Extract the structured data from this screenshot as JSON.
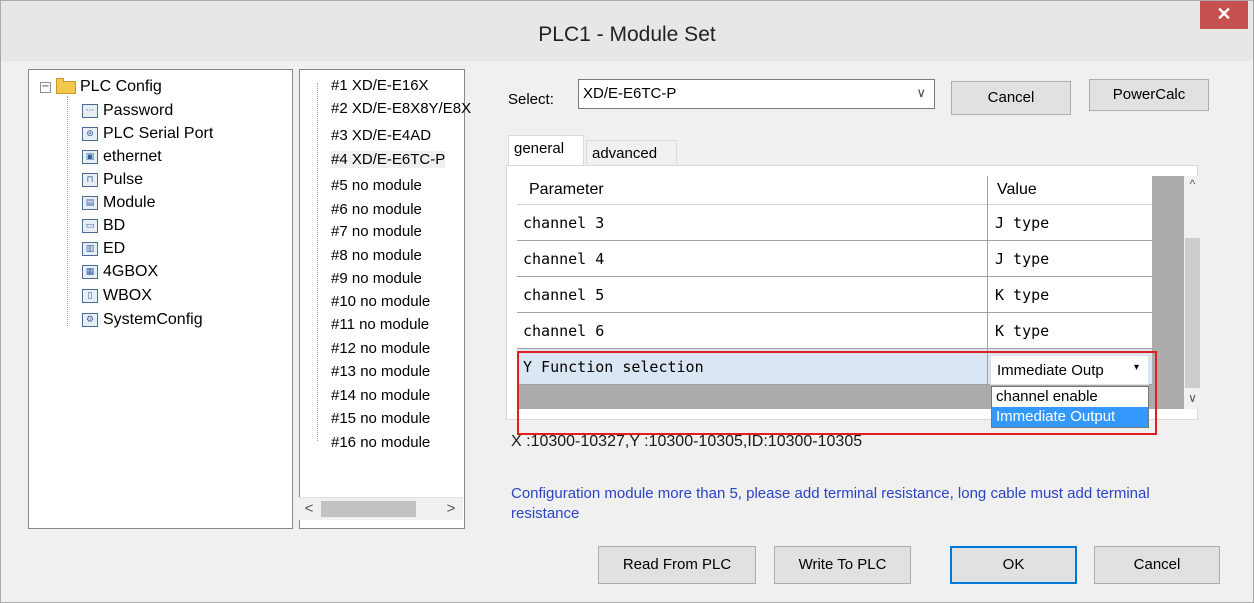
{
  "window": {
    "title": "PLC1 - Module  Set",
    "close_glyph": "✕"
  },
  "tree": {
    "root": {
      "label": "PLC Config",
      "expander": "−"
    },
    "items": [
      {
        "label": "Password",
        "icon": "password-icon",
        "glyph": "···"
      },
      {
        "label": "PLC Serial Port",
        "icon": "serial-port-icon",
        "glyph": "⊛"
      },
      {
        "label": "ethernet",
        "icon": "ethernet-icon",
        "glyph": "▣"
      },
      {
        "label": "Pulse",
        "icon": "pulse-icon",
        "glyph": "⊓"
      },
      {
        "label": "Module",
        "icon": "module-icon",
        "glyph": "▤"
      },
      {
        "label": "BD",
        "icon": "bd-icon",
        "glyph": "▭"
      },
      {
        "label": "ED",
        "icon": "ed-icon",
        "glyph": "▥"
      },
      {
        "label": "4GBOX",
        "icon": "4gbox-icon",
        "glyph": "▦"
      },
      {
        "label": "WBOX",
        "icon": "wbox-icon",
        "glyph": "▯"
      },
      {
        "label": "SystemConfig",
        "icon": "gear-icon",
        "glyph": "⚙"
      }
    ]
  },
  "modules": [
    "#1 XD/E-E16X",
    "#2 XD/E-E8X8Y/E8X",
    "#3 XD/E-E4AD",
    "#4 XD/E-E6TC-P",
    "#5 no module",
    "#6 no module",
    "#7 no module",
    "#8 no module",
    "#9 no module",
    "#10 no module",
    "#11 no module",
    "#12 no module",
    "#13 no module",
    "#14 no module",
    "#15 no module",
    "#16 no module"
  ],
  "select": {
    "label": "Select:",
    "value": "XD/E-E6TC-P",
    "chevron": "∨"
  },
  "buttons": {
    "cancel_top": "Cancel",
    "powercalc": "PowerCalc",
    "read": "Read From PLC",
    "write": "Write To PLC",
    "ok": "OK",
    "cancel_bottom": "Cancel"
  },
  "tabs": [
    "general",
    "advanced"
  ],
  "grid": {
    "headers": [
      "Parameter",
      "Value"
    ],
    "rows": [
      [
        "channel 3",
        "J type"
      ],
      [
        "channel 4",
        "J type"
      ],
      [
        "channel 5",
        "K type"
      ],
      [
        "channel 6",
        "K type"
      ],
      [
        "Y Function selection",
        ""
      ]
    ]
  },
  "combo": {
    "value": "Immediate Outp",
    "arrow": "▾"
  },
  "dropdown": {
    "options": [
      "channel enable",
      "Immediate Output"
    ],
    "selected_index": 1
  },
  "scroll": {
    "up": "^",
    "down": "∨",
    "left": "<",
    "right": ">"
  },
  "info": "X :10300-10327,Y :10300-10305,ID:10300-10305",
  "warning": "Configuration module more than 5, please add terminal resistance, long cable must add terminal resistance",
  "colors": {
    "close": "#c75050",
    "highlight": "#e21d20",
    "selection": "#3399ff",
    "warning_text": "#2a44c4"
  }
}
